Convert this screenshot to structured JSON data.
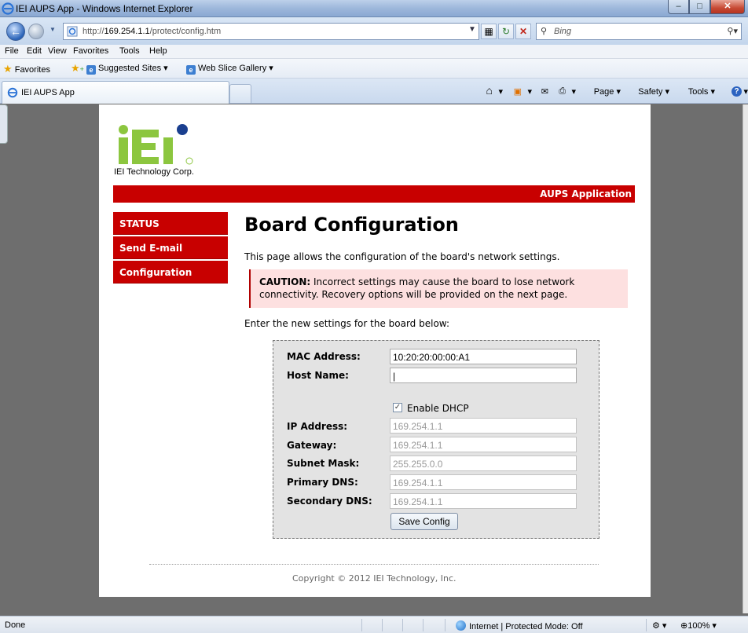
{
  "window": {
    "title": "IEI AUPS App - Windows Internet Explorer"
  },
  "address": {
    "url_prefix": "http://",
    "url_host": "169.254.1.1",
    "url_path": "/protect/config.htm",
    "search_placeholder": "Bing"
  },
  "menu": [
    "File",
    "Edit",
    "View",
    "Favorites",
    "Tools",
    "Help"
  ],
  "favorites": {
    "label": "Favorites",
    "suggested": "Suggested Sites ▾",
    "gallery": "Web Slice Gallery ▾"
  },
  "tab": {
    "label": "IEI AUPS App"
  },
  "commandbar": {
    "page": "Page ▾",
    "safety": "Safety ▾",
    "tools": "Tools ▾"
  },
  "page": {
    "company": "IEI Technology Corp.",
    "banner": "AUPS Application",
    "nav": [
      "STATUS",
      "Send E-mail",
      "Configuration"
    ],
    "title": "Board Configuration",
    "description": "This page allows the configuration of the board's network settings.",
    "caution_label": "CAUTION:",
    "caution_text": " Incorrect settings may cause the board to lose network connectivity. Recovery options will be provided on the next page.",
    "enter_text": "Enter the new settings for the board below:",
    "form": {
      "mac_label": "MAC Address:",
      "mac_value": "10:20:20:00:00:A1",
      "host_label": "Host Name:",
      "host_value": "|",
      "dhcp_label": "Enable DHCP",
      "dhcp_checked": true,
      "ip_label": "IP Address:",
      "ip_value": "169.254.1.1",
      "gw_label": "Gateway:",
      "gw_value": "169.254.1.1",
      "mask_label": "Subnet Mask:",
      "mask_value": "255.255.0.0",
      "dns1_label": "Primary DNS:",
      "dns1_value": "169.254.1.1",
      "dns2_label": "Secondary DNS:",
      "dns2_value": "169.254.1.1",
      "save_label": "Save Config"
    },
    "footer": "Copyright © 2012 IEI Technology, Inc."
  },
  "status": {
    "left": "Done",
    "zone": "Internet | Protected Mode: Off",
    "zoom": "100%"
  },
  "colors": {
    "brand_red": "#c80000",
    "caution_bg": "#fde0e0",
    "logo_green": "#8cc63f",
    "logo_blue": "#1a3f8f"
  }
}
